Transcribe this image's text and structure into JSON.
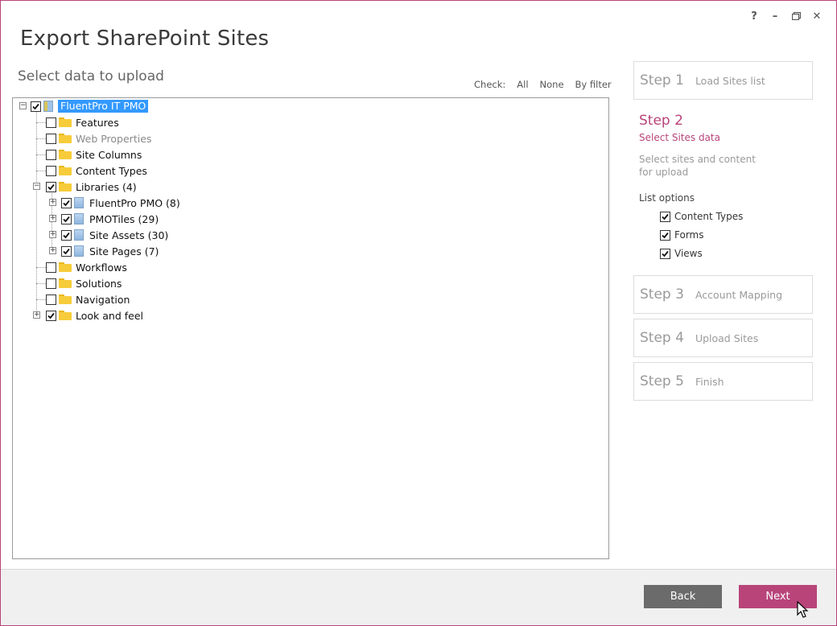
{
  "window": {
    "title": "Export SharePoint Sites",
    "controls": {
      "help": "?",
      "minimize": "–",
      "restore": "🗗",
      "close": "✕"
    }
  },
  "main": {
    "subtitle": "Select data to upload",
    "check": {
      "label": "Check:",
      "all": "All",
      "none": "None",
      "by_filter": "By filter"
    }
  },
  "tree": {
    "root": {
      "label": "FluentPro IT PMO",
      "checked": true
    },
    "items": [
      {
        "label": "Features",
        "checked": false
      },
      {
        "label": "Web Properties",
        "checked": false,
        "disabled": true
      },
      {
        "label": "Site Columns",
        "checked": false
      },
      {
        "label": "Content Types",
        "checked": false
      },
      {
        "label": "Libraries (4)",
        "checked": true
      },
      {
        "label": "FluentPro PMO (8)",
        "checked": true
      },
      {
        "label": "PMOTiles (29)",
        "checked": true
      },
      {
        "label": "Site Assets (30)",
        "checked": true
      },
      {
        "label": "Site Pages (7)",
        "checked": true
      },
      {
        "label": "Workflows",
        "checked": false
      },
      {
        "label": "Solutions",
        "checked": false
      },
      {
        "label": "Navigation",
        "checked": false
      },
      {
        "label": "Look and feel",
        "checked": true
      }
    ]
  },
  "steps": {
    "s1": {
      "num": "Step 1",
      "label": "Load Sites list"
    },
    "s2": {
      "num": "Step 2",
      "label": "Select Sites data",
      "desc_line1": "Select sites and content",
      "desc_line2": "for upload",
      "options_title": "List options",
      "options": [
        {
          "label": "Content Types",
          "checked": true
        },
        {
          "label": "Forms",
          "checked": true
        },
        {
          "label": "Views",
          "checked": true
        }
      ]
    },
    "s3": {
      "num": "Step 3",
      "label": "Account Mapping"
    },
    "s4": {
      "num": "Step 4",
      "label": "Upload Sites"
    },
    "s5": {
      "num": "Step 5",
      "label": "Finish"
    }
  },
  "footer": {
    "back": "Back",
    "next": "Next"
  },
  "colors": {
    "accent": "#b8447a",
    "selection": "#3399ff",
    "back_button": "#6b6b6b"
  }
}
